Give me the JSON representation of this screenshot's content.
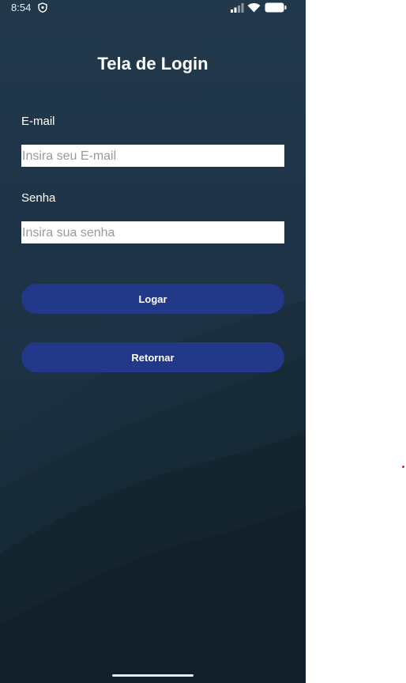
{
  "status_bar": {
    "time": "8:54"
  },
  "screen": {
    "title": "Tela de Login"
  },
  "form": {
    "email_label": "E-mail",
    "email_placeholder": "Insira seu E-mail",
    "email_value": "",
    "password_label": "Senha",
    "password_placeholder": "Insira sua senha",
    "password_value": ""
  },
  "buttons": {
    "login_label": "Logar",
    "back_label": "Retornar"
  },
  "colors": {
    "background": "#1d3143",
    "button": "#223889",
    "text": "#ffffff"
  }
}
